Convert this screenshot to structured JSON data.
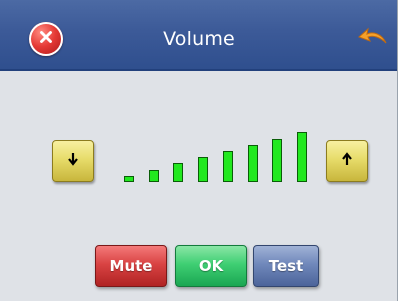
{
  "window": {
    "title": "Volume"
  },
  "titlebar": {
    "close_icon": "close-icon",
    "back_icon": "back-arrow-icon"
  },
  "volume": {
    "down_icon": "arrow-down-icon",
    "up_icon": "arrow-up-icon",
    "level_bars_count": 8,
    "bar_color": "#22e81f"
  },
  "buttons": {
    "mute_label": "Mute",
    "ok_label": "OK",
    "test_label": "Test"
  },
  "colors": {
    "titlebar": "#3c5a98",
    "content_bg": "#dfe2e7",
    "mute": "#d94343",
    "ok": "#3fcf73",
    "test": "#7088bb",
    "volume_button": "#e7dc6a"
  }
}
